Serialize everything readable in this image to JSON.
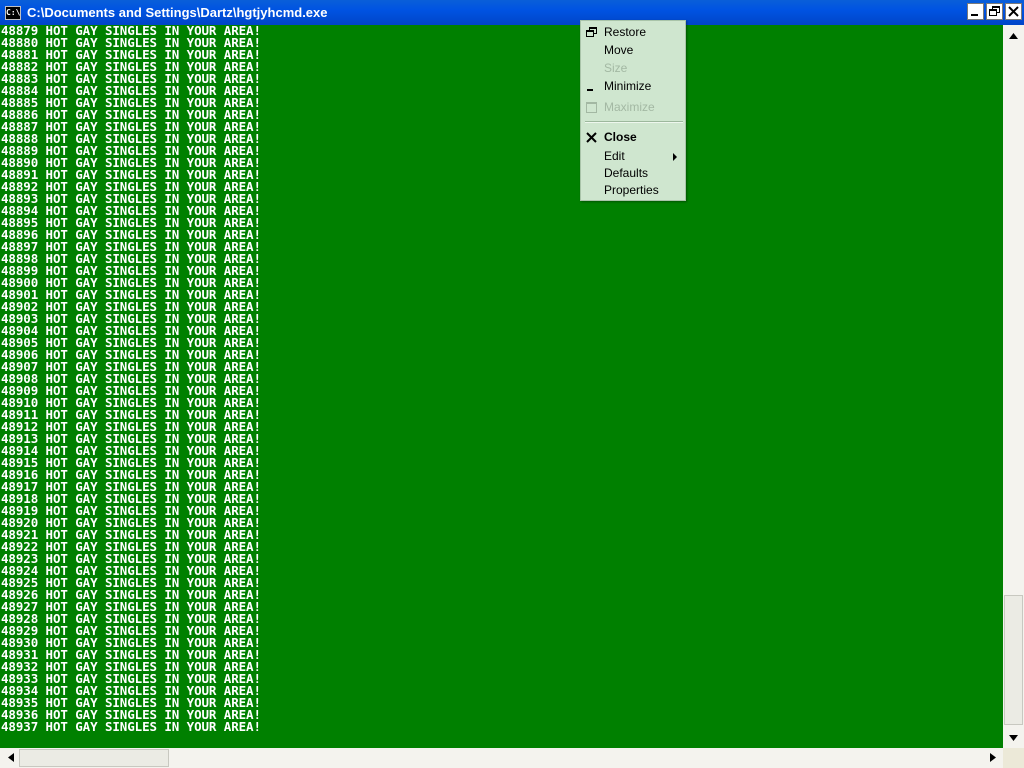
{
  "window": {
    "title": "C:\\Documents and Settings\\Dartz\\hgtjyhcmd.exe",
    "icon_text": "C:\\"
  },
  "console": {
    "text": "HOT GAY SINGLES IN YOUR AREA!",
    "lines": [
      "48879 HOT GAY SINGLES IN YOUR AREA!",
      "48880 HOT GAY SINGLES IN YOUR AREA!",
      "48881 HOT GAY SINGLES IN YOUR AREA!",
      "48882 HOT GAY SINGLES IN YOUR AREA!",
      "48883 HOT GAY SINGLES IN YOUR AREA!",
      "48884 HOT GAY SINGLES IN YOUR AREA!",
      "48885 HOT GAY SINGLES IN YOUR AREA!",
      "48886 HOT GAY SINGLES IN YOUR AREA!",
      "48887 HOT GAY SINGLES IN YOUR AREA!",
      "48888 HOT GAY SINGLES IN YOUR AREA!",
      "48889 HOT GAY SINGLES IN YOUR AREA!",
      "48890 HOT GAY SINGLES IN YOUR AREA!",
      "48891 HOT GAY SINGLES IN YOUR AREA!",
      "48892 HOT GAY SINGLES IN YOUR AREA!",
      "48893 HOT GAY SINGLES IN YOUR AREA!",
      "48894 HOT GAY SINGLES IN YOUR AREA!",
      "48895 HOT GAY SINGLES IN YOUR AREA!",
      "48896 HOT GAY SINGLES IN YOUR AREA!",
      "48897 HOT GAY SINGLES IN YOUR AREA!",
      "48898 HOT GAY SINGLES IN YOUR AREA!",
      "48899 HOT GAY SINGLES IN YOUR AREA!",
      "48900 HOT GAY SINGLES IN YOUR AREA!",
      "48901 HOT GAY SINGLES IN YOUR AREA!",
      "48902 HOT GAY SINGLES IN YOUR AREA!",
      "48903 HOT GAY SINGLES IN YOUR AREA!",
      "48904 HOT GAY SINGLES IN YOUR AREA!",
      "48905 HOT GAY SINGLES IN YOUR AREA!",
      "48906 HOT GAY SINGLES IN YOUR AREA!",
      "48907 HOT GAY SINGLES IN YOUR AREA!",
      "48908 HOT GAY SINGLES IN YOUR AREA!",
      "48909 HOT GAY SINGLES IN YOUR AREA!",
      "48910 HOT GAY SINGLES IN YOUR AREA!",
      "48911 HOT GAY SINGLES IN YOUR AREA!",
      "48912 HOT GAY SINGLES IN YOUR AREA!",
      "48913 HOT GAY SINGLES IN YOUR AREA!",
      "48914 HOT GAY SINGLES IN YOUR AREA!",
      "48915 HOT GAY SINGLES IN YOUR AREA!",
      "48916 HOT GAY SINGLES IN YOUR AREA!",
      "48917 HOT GAY SINGLES IN YOUR AREA!",
      "48918 HOT GAY SINGLES IN YOUR AREA!",
      "48919 HOT GAY SINGLES IN YOUR AREA!",
      "48920 HOT GAY SINGLES IN YOUR AREA!",
      "48921 HOT GAY SINGLES IN YOUR AREA!",
      "48922 HOT GAY SINGLES IN YOUR AREA!",
      "48923 HOT GAY SINGLES IN YOUR AREA!",
      "48924 HOT GAY SINGLES IN YOUR AREA!",
      "48925 HOT GAY SINGLES IN YOUR AREA!",
      "48926 HOT GAY SINGLES IN YOUR AREA!",
      "48927 HOT GAY SINGLES IN YOUR AREA!",
      "48928 HOT GAY SINGLES IN YOUR AREA!",
      "48929 HOT GAY SINGLES IN YOUR AREA!",
      "48930 HOT GAY SINGLES IN YOUR AREA!",
      "48931 HOT GAY SINGLES IN YOUR AREA!",
      "48932 HOT GAY SINGLES IN YOUR AREA!",
      "48933 HOT GAY SINGLES IN YOUR AREA!",
      "48934 HOT GAY SINGLES IN YOUR AREA!",
      "48935 HOT GAY SINGLES IN YOUR AREA!",
      "48936 HOT GAY SINGLES IN YOUR AREA!",
      "48937 HOT GAY SINGLES IN YOUR AREA!"
    ]
  },
  "system_menu": {
    "items": [
      {
        "label": "Restore",
        "icon": "restore-icon",
        "enabled": true
      },
      {
        "label": "Move",
        "icon": "",
        "enabled": true
      },
      {
        "label": "Size",
        "icon": "",
        "enabled": false
      },
      {
        "label": "Minimize",
        "icon": "minimize-icon",
        "enabled": true
      },
      {
        "label": "Maximize",
        "icon": "maximize-icon",
        "enabled": false
      },
      {
        "label": "Close",
        "icon": "close-icon",
        "enabled": true,
        "default": true
      },
      {
        "label": "Edit",
        "icon": "",
        "enabled": true,
        "submenu": true
      },
      {
        "label": "Defaults",
        "icon": "",
        "enabled": true
      },
      {
        "label": "Properties",
        "icon": "",
        "enabled": true
      }
    ]
  },
  "colors": {
    "console_background": "#008000",
    "console_text": "#ffffff",
    "titlebar": "#0053e2",
    "menu_background": "#cfe6cf"
  }
}
